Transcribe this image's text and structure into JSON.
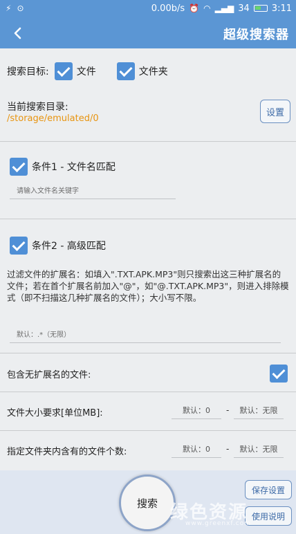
{
  "status_bar": {
    "net_speed": "0.00b/s",
    "signal": "34",
    "time": "3:11"
  },
  "app_bar": {
    "title": "超级搜索器"
  },
  "search_target": {
    "label": "搜索目标:",
    "options": [
      {
        "label": "文件",
        "checked": true
      },
      {
        "label": "文件夹",
        "checked": true
      }
    ]
  },
  "directory": {
    "label": "当前搜索目录:",
    "path": "/storage/emulated/0",
    "set_button": "设置"
  },
  "condition1": {
    "label": "条件1 - 文件名匹配",
    "checked": true,
    "placeholder": "请输入文件名关键字"
  },
  "condition2": {
    "label": "条件2 - 高级匹配",
    "checked": true,
    "description": "过滤文件的扩展名：如填入\".TXT.APK.MP3\"则只搜索出这三种扩展名的文件；若在首个扩展名前加入\"@\"，如\"@.TXT.APK.MP3\"，则进入排除模式（即不扫描这几种扩展名的文件）；大小写不限。",
    "placeholder": "默认：.*（无限）"
  },
  "no_ext": {
    "label": "包含无扩展名的文件:",
    "checked": true
  },
  "size_req": {
    "label": "文件大小要求[单位MB]:",
    "min_placeholder": "默认：0",
    "separator": "-",
    "max_placeholder": "默认：无限"
  },
  "count_req": {
    "label": "指定文件夹内含有的文件个数:",
    "min_placeholder": "默认：0",
    "separator": "-",
    "max_placeholder": "默认：无限"
  },
  "bottom": {
    "search_button": "搜索",
    "save_button": "保存设置",
    "help_button": "使用说明",
    "watermark": "绿色资源",
    "watermark_url": "www.greenxf.com"
  },
  "colors": {
    "accent": "#5b96d4",
    "path": "#e8940f",
    "checkbox": "#4f8fd6"
  }
}
